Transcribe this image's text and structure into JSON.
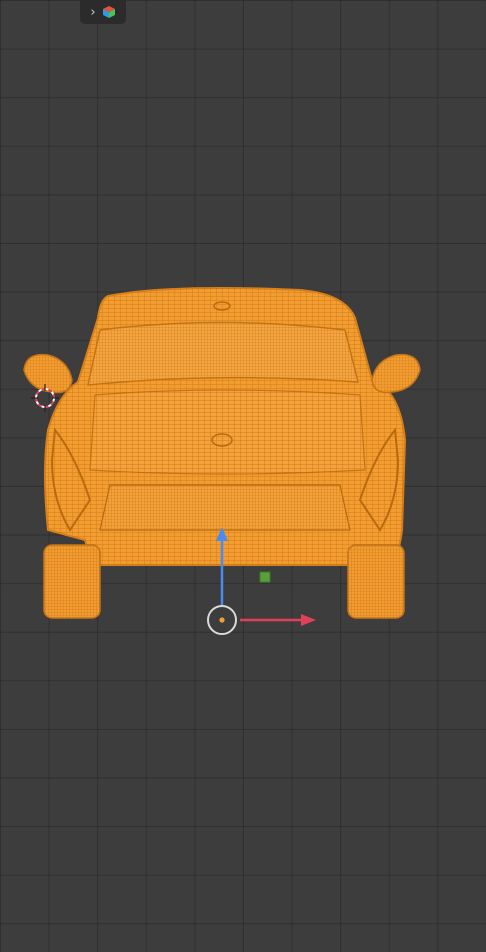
{
  "header": {
    "chevron_glyph": "›",
    "editor_icon": "scene-cube-icon"
  },
  "colors": {
    "background": "#3d3d3d",
    "grid_line": "#303030",
    "wireframe": "#f39c30",
    "axis_z": "#4a8bf0",
    "axis_x": "#e0405a",
    "pivot_ring": "#d9d9d9",
    "pivot_dot": "#f0a030",
    "handle_green": "#5aa03a"
  },
  "viewport": {
    "object": "car-wireframe",
    "mode": "edit"
  }
}
